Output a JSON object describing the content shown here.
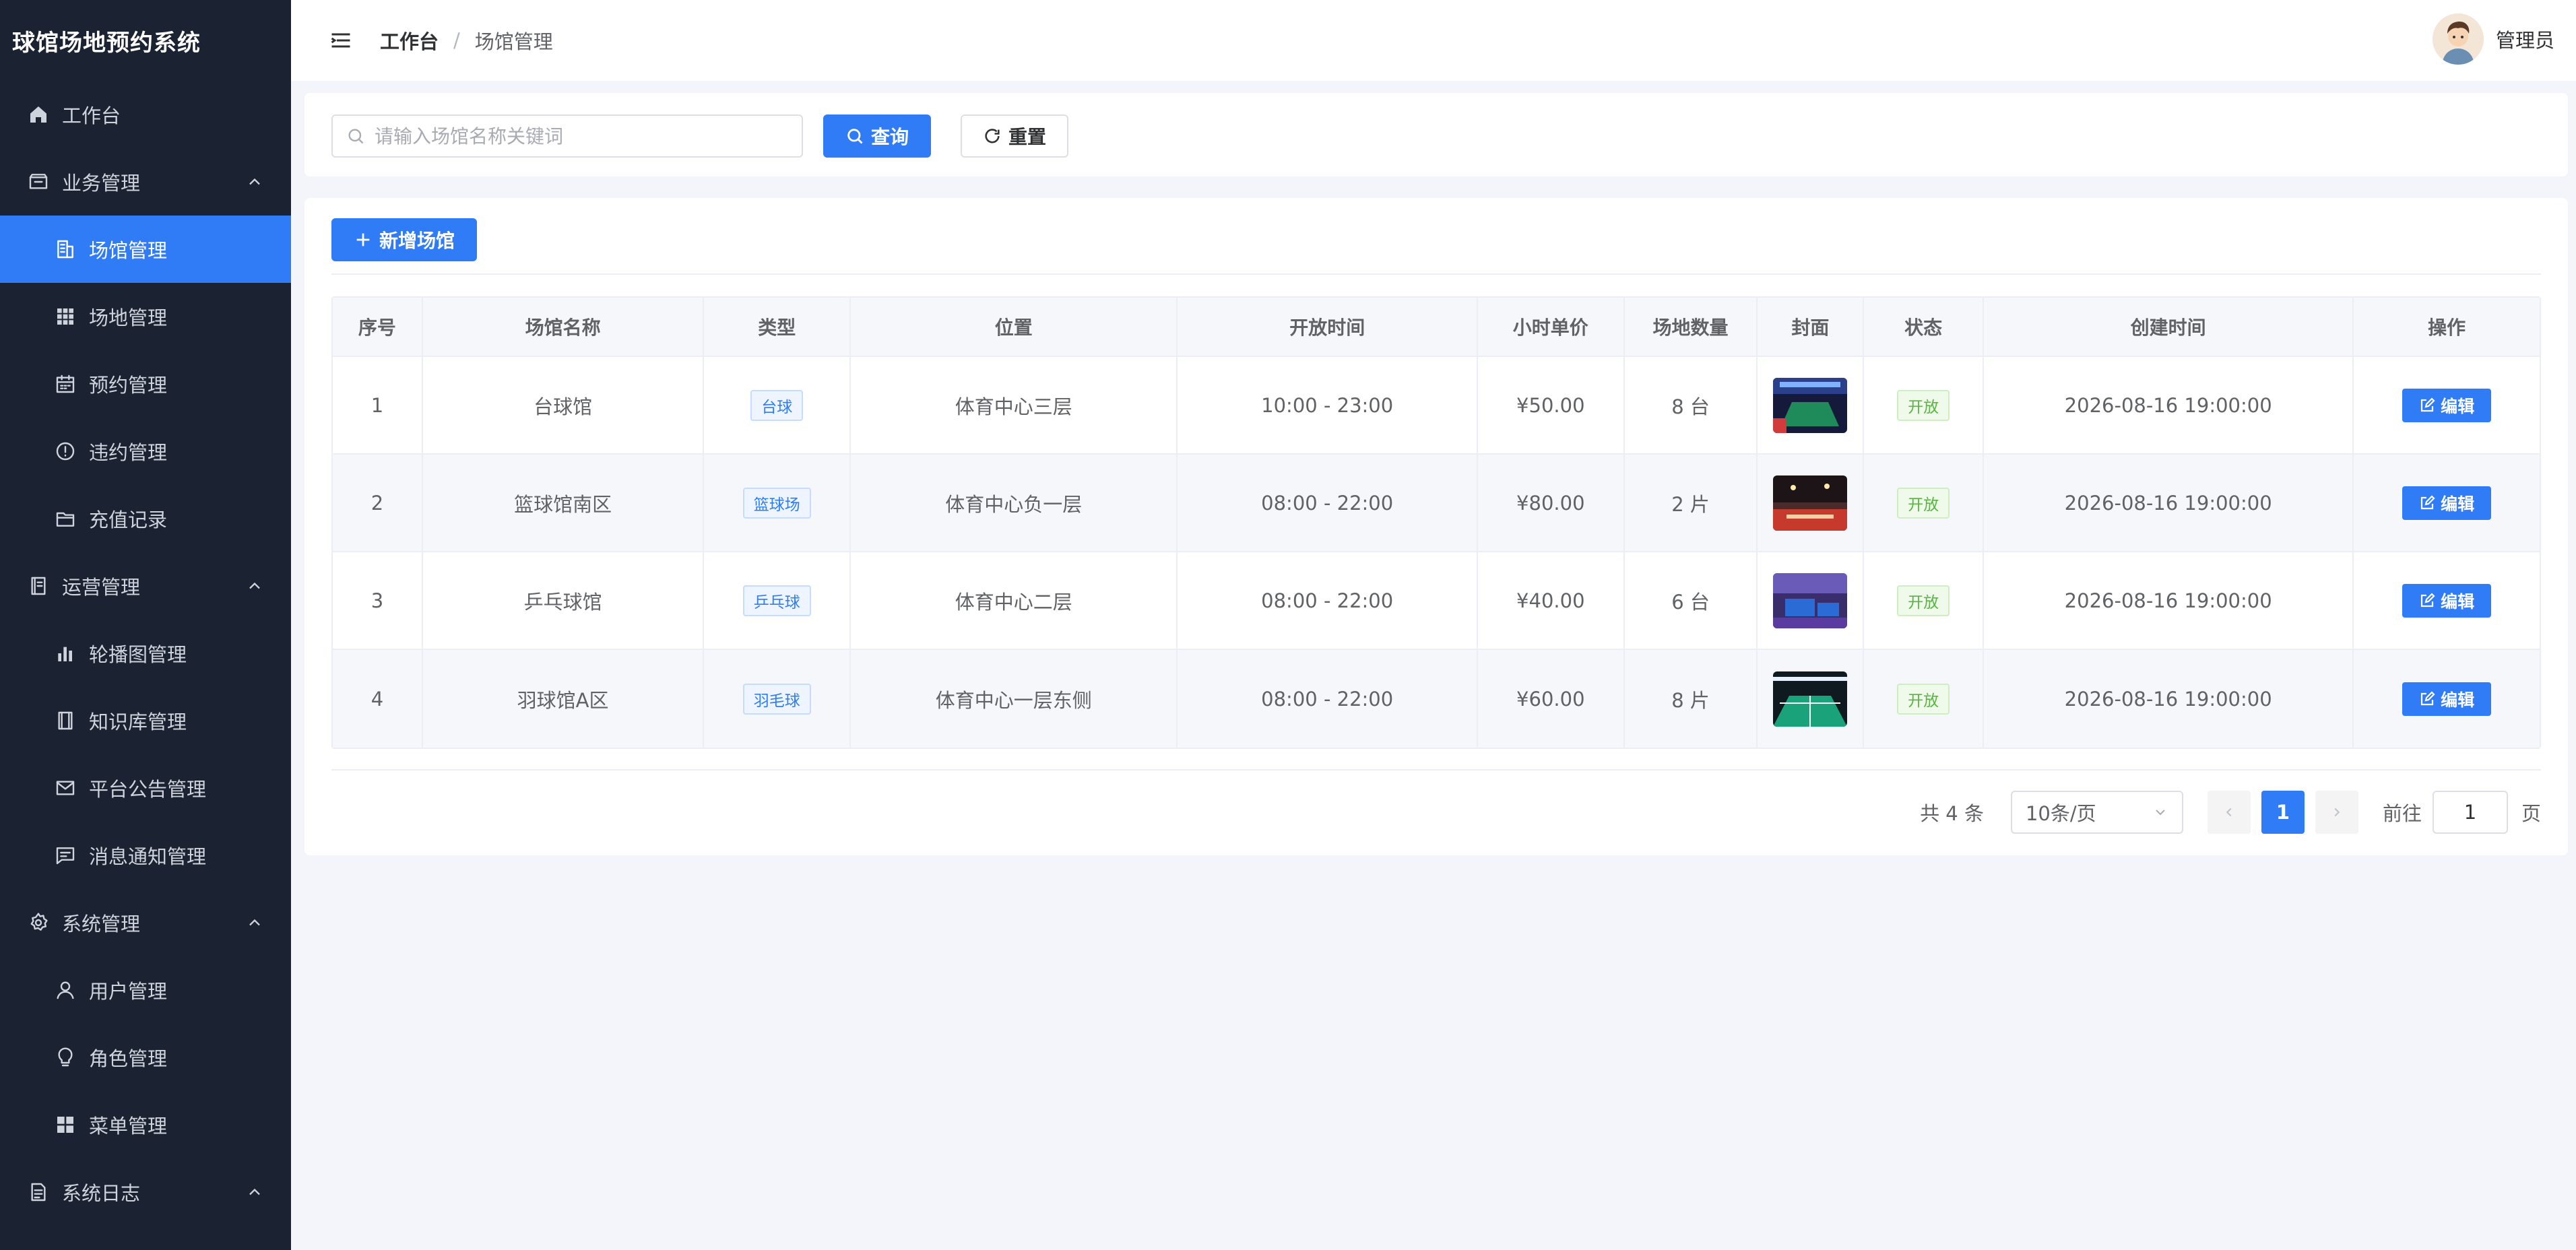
{
  "app": {
    "title": "球馆场地预约系统"
  },
  "sidebar": {
    "items": [
      {
        "label": "工作台",
        "icon": "home-icon",
        "level": "top"
      },
      {
        "label": "业务管理",
        "icon": "box-icon",
        "level": "top",
        "expandable": true
      },
      {
        "label": "场馆管理",
        "icon": "building-icon",
        "level": "sub",
        "active": true
      },
      {
        "label": "场地管理",
        "icon": "grid-icon",
        "level": "sub"
      },
      {
        "label": "预约管理",
        "icon": "calendar-icon",
        "level": "sub"
      },
      {
        "label": "违约管理",
        "icon": "warning-icon",
        "level": "sub"
      },
      {
        "label": "充值记录",
        "icon": "folder-icon",
        "level": "sub"
      },
      {
        "label": "运营管理",
        "icon": "document-icon",
        "level": "top",
        "expandable": true
      },
      {
        "label": "轮播图管理",
        "icon": "chart-icon",
        "level": "sub"
      },
      {
        "label": "知识库管理",
        "icon": "book-icon",
        "level": "sub"
      },
      {
        "label": "平台公告管理",
        "icon": "mail-icon",
        "level": "sub"
      },
      {
        "label": "消息通知管理",
        "icon": "chat-icon",
        "level": "sub"
      },
      {
        "label": "系统管理",
        "icon": "gear-icon",
        "level": "top",
        "expandable": true
      },
      {
        "label": "用户管理",
        "icon": "user-icon",
        "level": "sub"
      },
      {
        "label": "角色管理",
        "icon": "bulb-icon",
        "level": "sub"
      },
      {
        "label": "菜单管理",
        "icon": "tiles-icon",
        "level": "sub"
      },
      {
        "label": "系统日志",
        "icon": "log-icon",
        "level": "top",
        "expandable": true
      }
    ]
  },
  "header": {
    "breadcrumb": [
      "工作台",
      "场馆管理"
    ],
    "user_name": "管理员"
  },
  "search": {
    "placeholder": "请输入场馆名称关键词",
    "value": "",
    "query_label": "查询",
    "reset_label": "重置"
  },
  "toolbar": {
    "add_label": "新增场馆"
  },
  "table": {
    "columns": [
      "序号",
      "场馆名称",
      "类型",
      "位置",
      "开放时间",
      "小时单价",
      "场地数量",
      "封面",
      "状态",
      "创建时间",
      "操作"
    ],
    "rows": [
      {
        "index": "1",
        "name": "台球馆",
        "type": "台球",
        "location": "体育中心三层",
        "hours": "10:00 - 23:00",
        "price": "¥50.00",
        "count": "8 台",
        "status": "开放",
        "created": "2026-08-16 19:00:00",
        "action": "编辑"
      },
      {
        "index": "2",
        "name": "篮球馆南区",
        "type": "篮球场",
        "location": "体育中心负一层",
        "hours": "08:00 - 22:00",
        "price": "¥80.00",
        "count": "2 片",
        "status": "开放",
        "created": "2026-08-16 19:00:00",
        "action": "编辑"
      },
      {
        "index": "3",
        "name": "乒乓球馆",
        "type": "乒乓球",
        "location": "体育中心二层",
        "hours": "08:00 - 22:00",
        "price": "¥40.00",
        "count": "6 台",
        "status": "开放",
        "created": "2026-08-16 19:00:00",
        "action": "编辑"
      },
      {
        "index": "4",
        "name": "羽球馆A区",
        "type": "羽毛球",
        "location": "体育中心一层东侧",
        "hours": "08:00 - 22:00",
        "price": "¥60.00",
        "count": "8 片",
        "status": "开放",
        "created": "2026-08-16 19:00:00",
        "action": "编辑"
      }
    ]
  },
  "pagination": {
    "total_text": "共 4 条",
    "page_size": "10条/页",
    "current_page": "1",
    "goto_label": "前往",
    "goto_value": "1",
    "page_unit": "页"
  },
  "colors": {
    "primary": "#2f7cf6",
    "sidebar_bg": "#1b2232",
    "page_bg": "#f3f5fb",
    "success": "#58b540"
  }
}
